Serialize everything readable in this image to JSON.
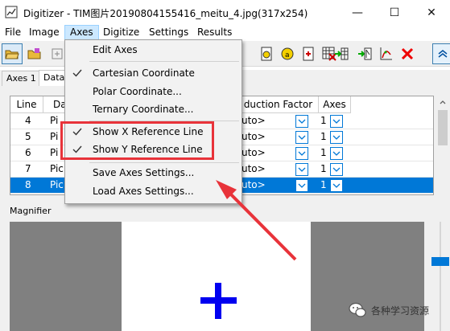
{
  "window": {
    "title": "Digitizer - TIM图片20190804155416_meitu_4.jpg(317x254)",
    "minimize_glyph": "—",
    "maximize_glyph": "☐",
    "close_glyph": "✕"
  },
  "menubar": {
    "items": [
      "File",
      "Image",
      "Axes",
      "Digitize",
      "Settings",
      "Results"
    ]
  },
  "axes_menu": {
    "edit_axes": "Edit Axes",
    "cartesian": "Cartesian Coordinate",
    "polar": "Polar Coordinate...",
    "ternary": "Ternary Coordinate...",
    "show_x_ref": "Show X Reference Line",
    "show_y_ref": "Show Y Reference Line",
    "save_axes": "Save Axes Settings...",
    "load_axes": "Load Axes Settings..."
  },
  "tabs": [
    "Axes 1",
    "Data"
  ],
  "grid": {
    "headers": {
      "line": "Line",
      "data": "Da",
      "reduction": "duction Factor",
      "axes": "Axes"
    },
    "rows": [
      {
        "line": "4",
        "data": "Pi",
        "reduction": "uto>",
        "axes": "1"
      },
      {
        "line": "5",
        "data": "Pi",
        "reduction": "uto>",
        "axes": "1"
      },
      {
        "line": "6",
        "data": "Pi",
        "reduction": "uto>",
        "axes": "1"
      },
      {
        "line": "7",
        "data": "Picl",
        "reduction": "uto>",
        "axes": "1"
      },
      {
        "line": "8",
        "data": "Picl",
        "reduction": "uto>",
        "axes": "1"
      }
    ]
  },
  "magnifier_label": "Magnifier",
  "watermark": "各种学习资源",
  "colors": {
    "highlight": "#e8333a",
    "selection": "#0078d7",
    "crosshair": "#0000f0"
  }
}
